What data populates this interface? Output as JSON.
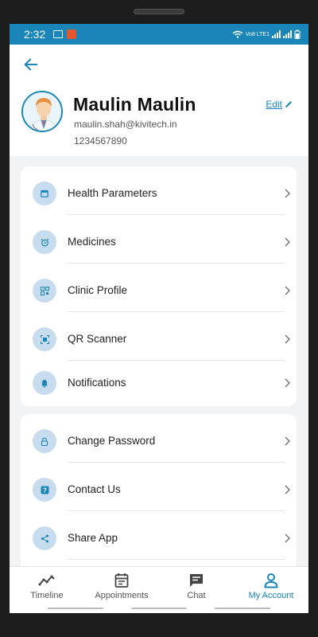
{
  "status_bar": {
    "time": "2:32",
    "network_label": "Vo8 LTE1"
  },
  "profile": {
    "name": "Maulin Maulin",
    "email": "maulin.shah@kivitech.in",
    "phone": "1234567890",
    "edit_label": "Edit"
  },
  "menu_group_1": [
    {
      "label": "Health Parameters",
      "icon": "calendar-icon"
    },
    {
      "label": "Medicines",
      "icon": "alarm-clock-icon"
    },
    {
      "label": "Clinic Profile",
      "icon": "clinic-qr-icon"
    },
    {
      "label": "QR Scanner",
      "icon": "qr-scan-icon"
    },
    {
      "label": "Notifications",
      "icon": "bell-icon"
    }
  ],
  "menu_group_2": [
    {
      "label": "Change Password",
      "icon": "lock-icon"
    },
    {
      "label": "Contact Us",
      "icon": "help-icon"
    },
    {
      "label": "Share App",
      "icon": "share-icon"
    }
  ],
  "bottom_nav": [
    {
      "label": "Timeline",
      "icon": "timeline-icon",
      "active": false
    },
    {
      "label": "Appointments",
      "icon": "appointments-icon",
      "active": false
    },
    {
      "label": "Chat",
      "icon": "chat-icon",
      "active": false
    },
    {
      "label": "My Account",
      "icon": "account-icon",
      "active": true
    }
  ],
  "colors": {
    "accent": "#1985b9",
    "icon_bg": "#c8dcef",
    "background": "#f2f3f5"
  }
}
